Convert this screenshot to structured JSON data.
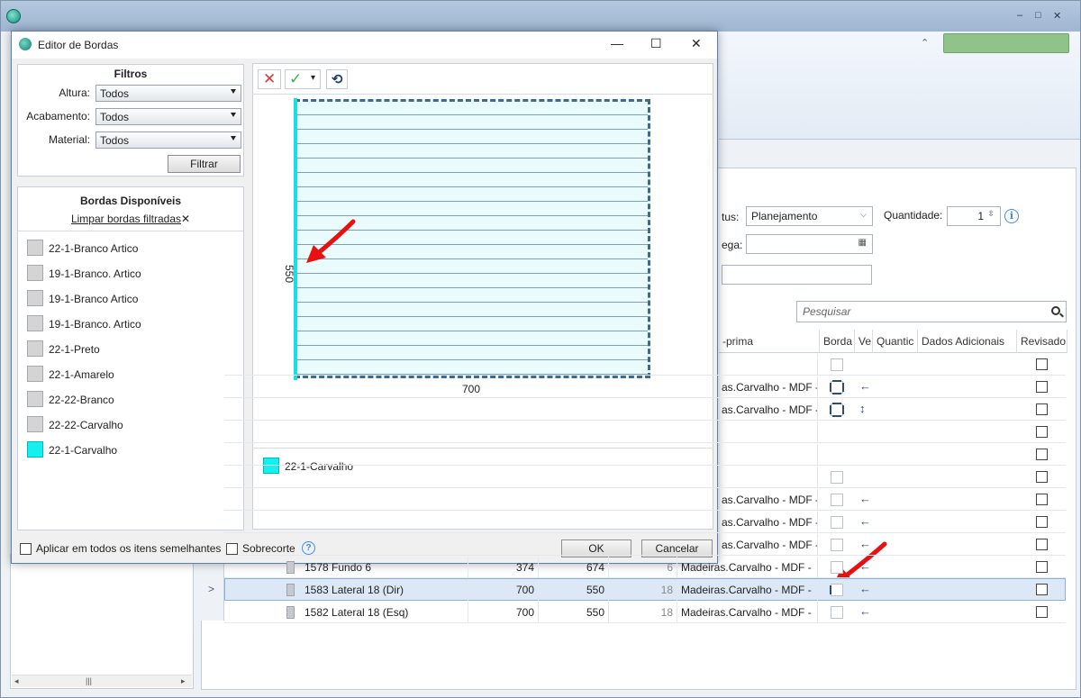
{
  "main_window": {
    "window_controls": {
      "minimize": "–",
      "maximize": "□",
      "close": "✕"
    },
    "ribbon_collapse": "⌃"
  },
  "form": {
    "status_label": "tus:",
    "status_value": "Planejamento",
    "delivery_label": "ega:",
    "delivery_value": "",
    "quantity_label": "Quantidade:",
    "quantity_value": "1",
    "info_icon": "i",
    "extra_value": ""
  },
  "search": {
    "placeholder": "Pesquisar"
  },
  "grid": {
    "headers": {
      "material": "-prima",
      "borda": "Borda",
      "ve": "Ve",
      "quantity": "Quantic",
      "additional": "Dados Adicionais",
      "reviewed": "Revisado"
    },
    "rows": [
      {
        "name": "",
        "w": "",
        "h": "",
        "thick": "",
        "material": "",
        "dir": ""
      },
      {
        "name": "",
        "w": "",
        "h": "",
        "thick": "",
        "material": "as.Carvalho - MDF -",
        "dir": "←"
      },
      {
        "name": "",
        "w": "",
        "h": "",
        "thick": "",
        "material": "as.Carvalho - MDF -",
        "dir": "↕"
      },
      {
        "name": "",
        "w": "",
        "h": "",
        "thick": "",
        "material": "",
        "dir": ""
      },
      {
        "name": "",
        "w": "",
        "h": "",
        "thick": "",
        "material": "",
        "dir": ""
      },
      {
        "name": "",
        "w": "",
        "h": "",
        "thick": "",
        "material": "",
        "dir": ""
      },
      {
        "name": "",
        "w": "",
        "h": "",
        "thick": "",
        "material": "as.Carvalho - MDF -",
        "dir": "←"
      },
      {
        "name": "",
        "w": "",
        "h": "",
        "thick": "",
        "material": "as.Carvalho - MDF -",
        "dir": "←"
      },
      {
        "name": "",
        "w": "",
        "h": "",
        "thick": "",
        "material": "as.Carvalho - MDF -",
        "dir": "←"
      },
      {
        "name": "1578 Fundo 6",
        "w": "374",
        "h": "674",
        "thick": "6",
        "material": "Madeiras.Carvalho - MDF -",
        "dir": "←"
      },
      {
        "name": "1583 Lateral 18 (Dir)",
        "w": "700",
        "h": "550",
        "thick": "18",
        "material": "Madeiras.Carvalho - MDF -",
        "dir": "←"
      },
      {
        "name": "1582 Lateral 18 (Esq)",
        "w": "700",
        "h": "550",
        "thick": "18",
        "material": "Madeiras.Carvalho - MDF -",
        "dir": "←"
      }
    ],
    "selected_indicator": ">"
  },
  "left_scroll": {
    "left": "◂",
    "thumb": "|||",
    "right": "▸"
  },
  "dialog": {
    "title": "Editor de Bordas",
    "controls": {
      "minimize": "—",
      "maximize": "☐",
      "close": "✕"
    },
    "filters": {
      "title": "Filtros",
      "altura_label": "Altura:",
      "altura_value": "Todos",
      "acabamento_label": "Acabamento:",
      "acabamento_value": "Todos",
      "material_label": "Material:",
      "material_value": "Todos",
      "filter_button": "Filtrar"
    },
    "available": {
      "title": "Bordas Disponíveis",
      "clear_link": "Limpar bordas filtradas",
      "clear_icon": "✕",
      "items": [
        {
          "name": "22-1-Branco Artico",
          "color": "#d4d4d4"
        },
        {
          "name": "19-1-Branco. Artico",
          "color": "#d4d4d4"
        },
        {
          "name": "19-1-Branco Artico",
          "color": "#d4d4d4"
        },
        {
          "name": "19-1-Branco. Artico",
          "color": "#d4d4d4"
        },
        {
          "name": "22-1-Preto",
          "color": "#d4d4d4"
        },
        {
          "name": "22-1-Amarelo",
          "color": "#d4d4d4"
        },
        {
          "name": "22-22-Branco",
          "color": "#d4d4d4"
        },
        {
          "name": "22-22-Carvalho",
          "color": "#d4d4d4"
        },
        {
          "name": "22-1-Carvalho",
          "color": "#14f0f0"
        }
      ]
    },
    "toolbar": {
      "remove_icon": "✕",
      "apply_icon": "✓",
      "apply_dropdown": "▾",
      "rotate_icon": "⟲"
    },
    "board": {
      "width_label": "700",
      "height_label": "550",
      "left_edge_color": "#14e0e6"
    },
    "legend": {
      "name": "22-1-Carvalho",
      "color": "#14f0f0"
    },
    "footer": {
      "apply_all_label": "Aplicar em todos os itens semelhantes",
      "sobrecorte_label": "Sobrecorte",
      "help_icon": "?",
      "ok_label": "OK",
      "cancel_label": "Cancelar"
    }
  }
}
